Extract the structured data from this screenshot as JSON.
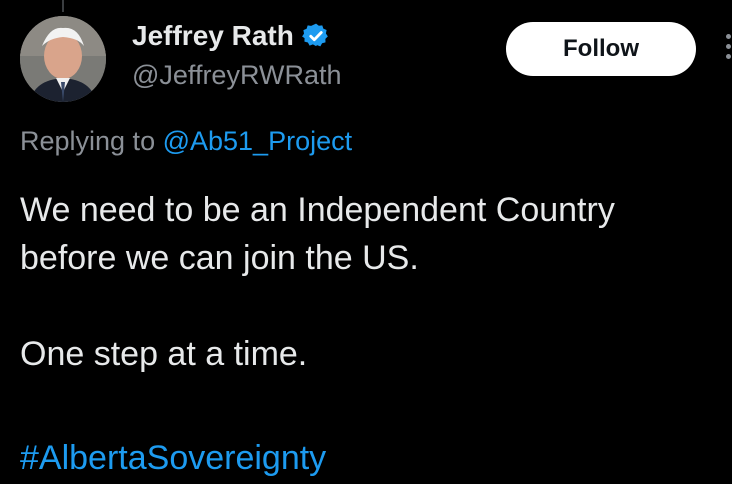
{
  "author": {
    "display_name": "Jeffrey Rath",
    "handle": "@JeffreyRWRath",
    "verified": true,
    "avatar": "profile-photo"
  },
  "follow_button": {
    "label": "Follow"
  },
  "more_menu": {
    "icon": "more-vertical-icon"
  },
  "reply": {
    "prefix": "Replying to ",
    "mention": "@Ab51_Project"
  },
  "tweet": {
    "line1": "We need to be an Independent Country",
    "line2": "before we can join the US.",
    "line3": "One step at a time.",
    "hashtag": "#AlbertaSovereignty"
  },
  "colors": {
    "background": "#000000",
    "text": "#e7e9ea",
    "secondary_text": "#8b9097",
    "link": "#1d9bf0",
    "verified_badge": "#1d9bf0",
    "follow_bg": "#ffffff"
  }
}
